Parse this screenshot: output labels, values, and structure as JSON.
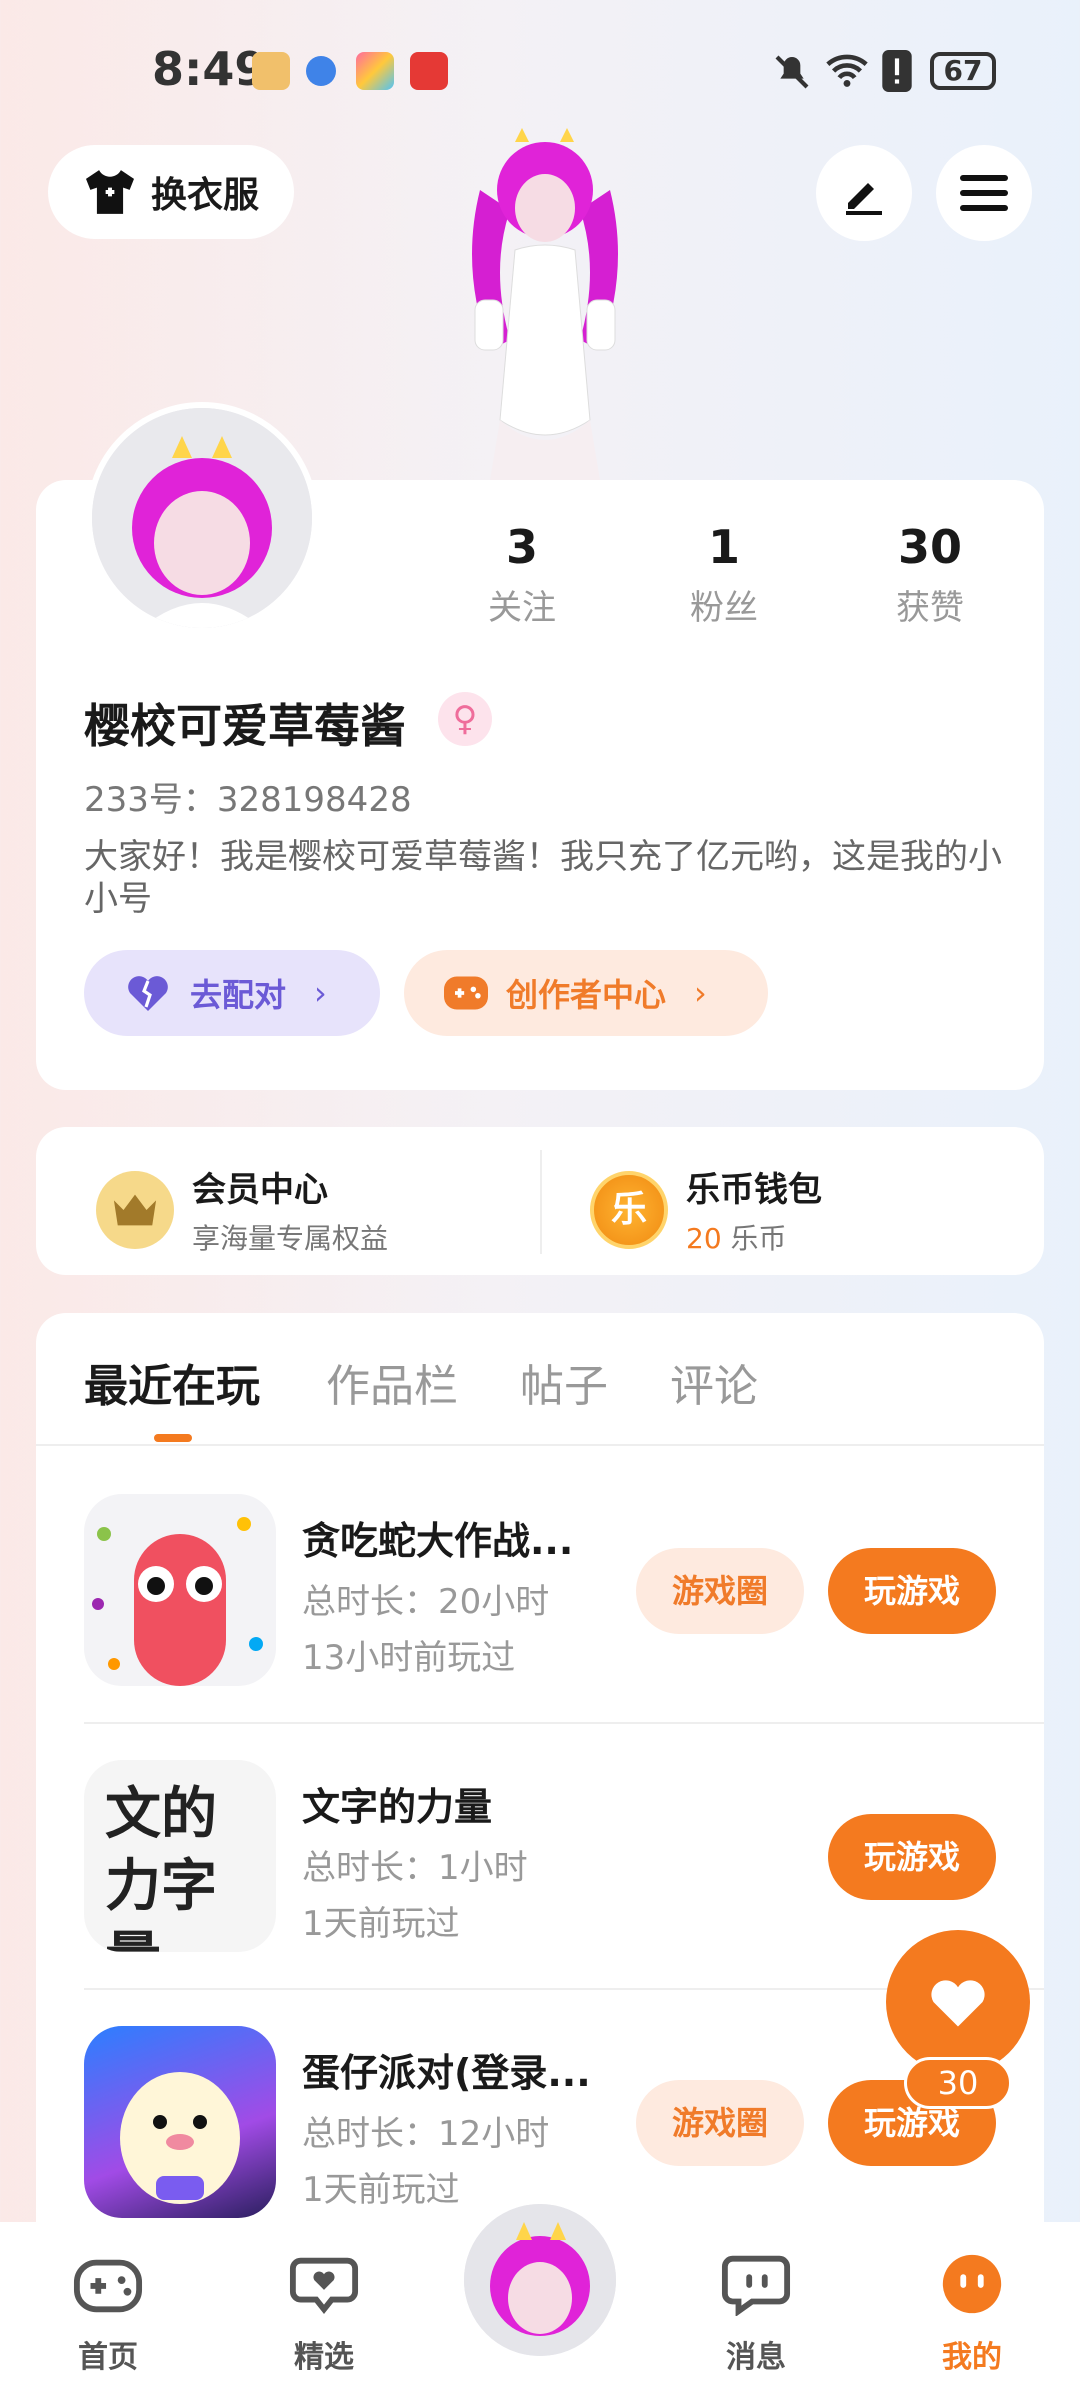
{
  "status_bar": {
    "time": "8:49",
    "battery": "67"
  },
  "header": {
    "outfit_label": "换衣服"
  },
  "profile": {
    "stats": [
      {
        "value": "3",
        "label": "关注"
      },
      {
        "value": "1",
        "label": "粉丝"
      },
      {
        "value": "30",
        "label": "获赞"
      }
    ],
    "nickname": "樱校可爱草莓酱",
    "gender_symbol": "♀",
    "uid": "233号：328198428",
    "bio": "大家好！我是樱校可爱草莓酱！我只充了亿元哟，这是我的小小号",
    "match_label": "去配对",
    "creator_label": "创作者中心"
  },
  "vip": {
    "title": "会员中心",
    "subtitle": "享海量专属权益",
    "wallet_title": "乐币钱包",
    "wallet_amount": "20",
    "wallet_unit": "乐币",
    "wallet_icon_text": "乐"
  },
  "tabs": [
    "最近在玩",
    "作品栏",
    "帖子",
    "评论"
  ],
  "games": [
    {
      "name": "贪吃蛇大作战...",
      "duration": "总时长：20小时",
      "last_played": "13小时前玩过",
      "circle_label": "游戏圈",
      "play_label": "玩游戏"
    },
    {
      "name": "文字的力量",
      "duration": "总时长：1小时",
      "last_played": "1天前玩过",
      "play_label": "玩游戏",
      "icon_text": "文的力字量"
    },
    {
      "name": "蛋仔派对(登录...",
      "duration": "总时长：12小时",
      "last_played": "1天前玩过",
      "circle_label": "游戏圈",
      "play_label": "玩游戏"
    }
  ],
  "like_count": "30",
  "nav": [
    "首页",
    "精选",
    "消息",
    "我的"
  ],
  "colors": {
    "accent": "#f47a1f",
    "match": "#6b5ad6"
  }
}
